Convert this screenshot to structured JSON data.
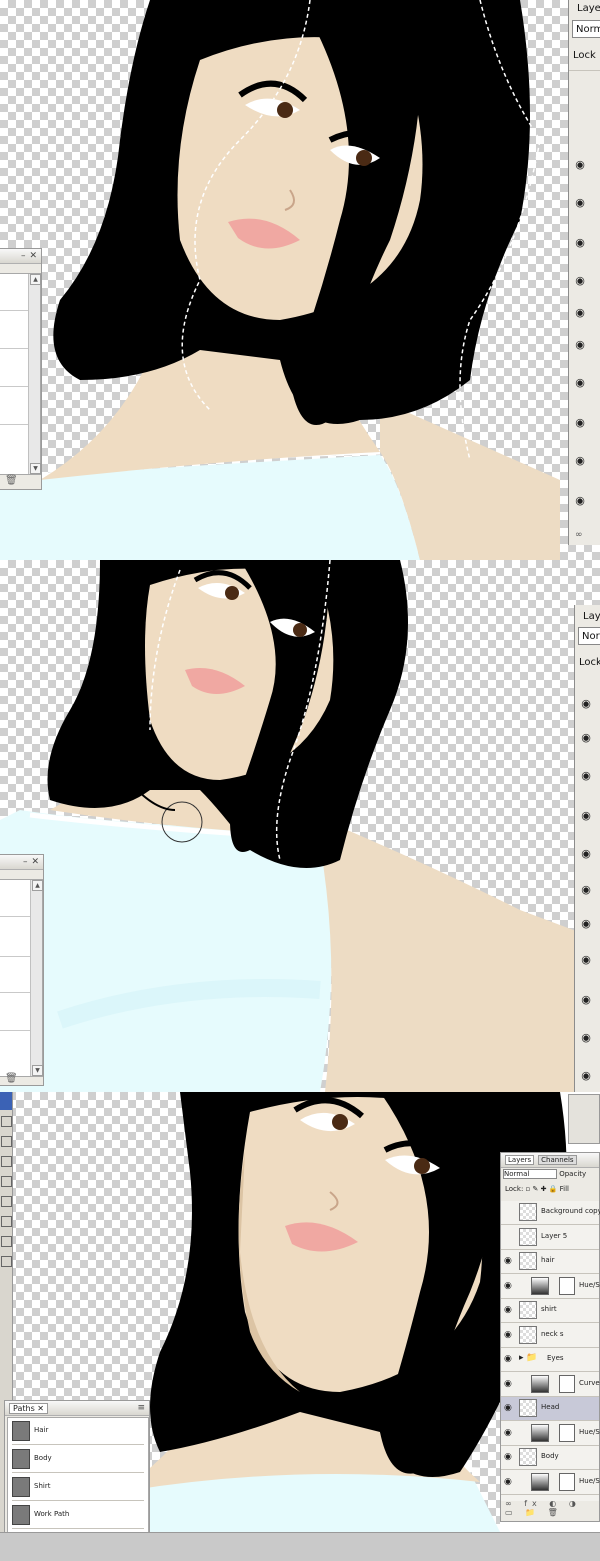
{
  "section1": {
    "layers_panel": {
      "tab_label": "Laye",
      "blend_mode": "Norm",
      "lock_label": "Lock"
    }
  },
  "section2": {
    "layers_panel": {
      "tab_label": "Lay",
      "blend_mode": "Norm",
      "lock_label": "Lock"
    }
  },
  "section3": {
    "paths_panel": {
      "tab_label": "Paths",
      "items": [
        {
          "name": "Hair"
        },
        {
          "name": "Body"
        },
        {
          "name": "Shirt"
        },
        {
          "name": "Work Path"
        }
      ]
    },
    "layers_panel": {
      "tabs": [
        "Layers",
        "Channels"
      ],
      "blend_mode": "Normal",
      "opacity_label": "Opacity",
      "lock_label": "Lock:",
      "fill_label": "Fill",
      "layers": [
        {
          "name": "Background copy",
          "visible": false
        },
        {
          "name": "Layer 5",
          "visible": false
        },
        {
          "name": "hair",
          "visible": true
        },
        {
          "name": "",
          "visible": true,
          "type": "adjustment"
        },
        {
          "name": "shirt",
          "visible": true
        },
        {
          "name": "neck s",
          "visible": true
        },
        {
          "name": "Eyes",
          "visible": true,
          "type": "group"
        },
        {
          "name": "",
          "visible": true,
          "type": "adjustment"
        },
        {
          "name": "Head",
          "visible": true,
          "selected": true
        },
        {
          "name": "",
          "visible": true,
          "type": "curves"
        },
        {
          "name": "Body",
          "visible": true
        },
        {
          "name": "",
          "visible": true,
          "type": "adjustment"
        }
      ],
      "adj_labels": [
        "Hue/S",
        "Curve",
        "Hue/S",
        "Hue/S"
      ]
    }
  }
}
